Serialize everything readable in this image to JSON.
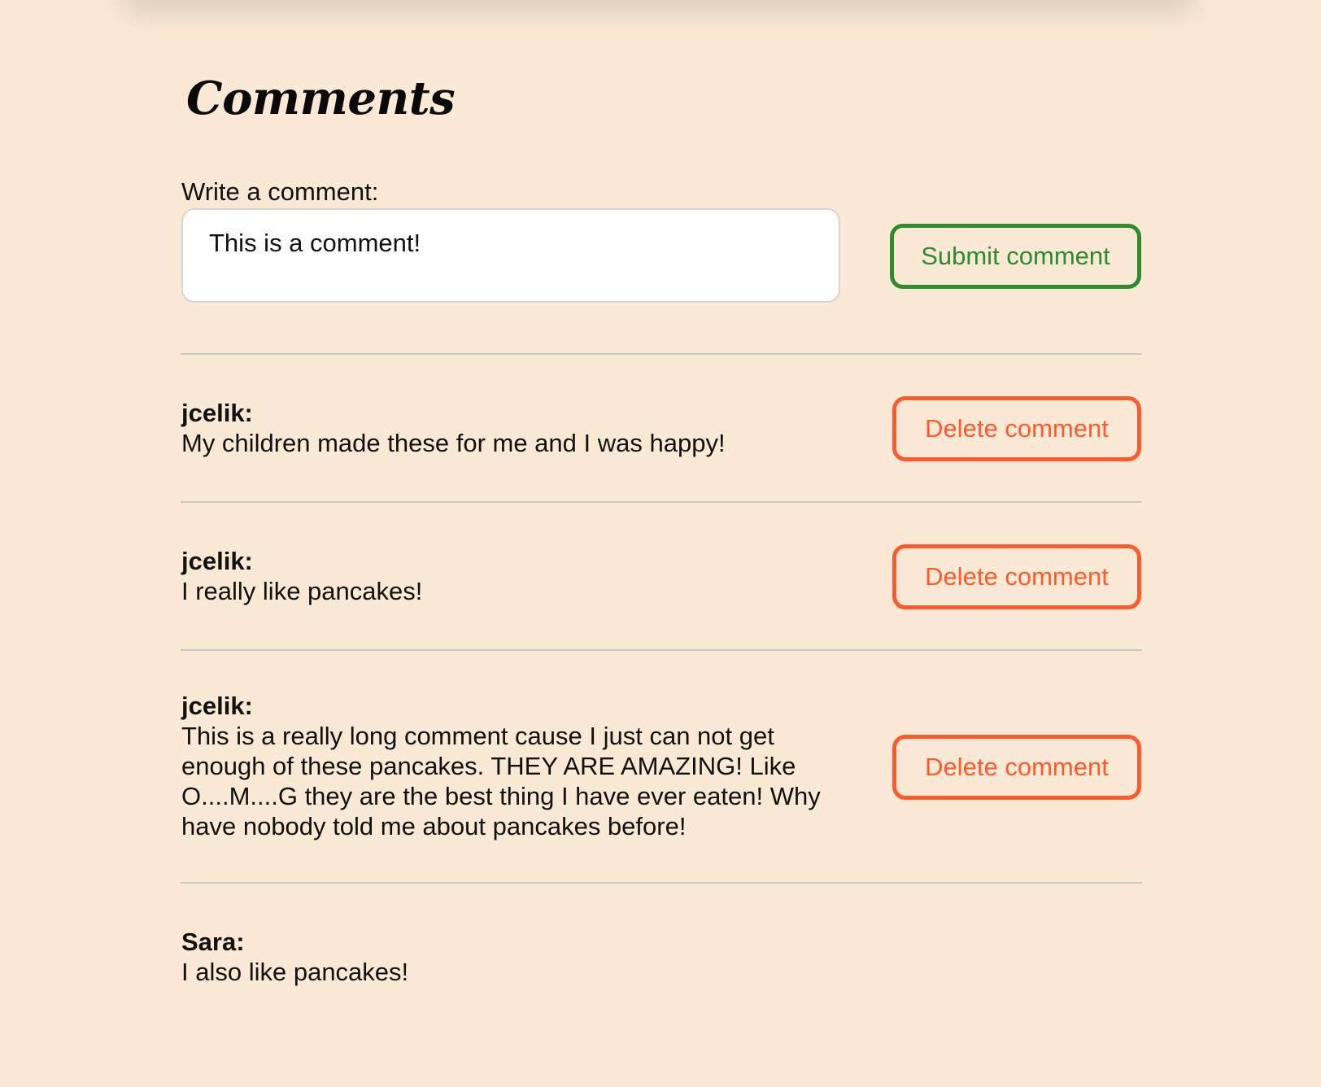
{
  "title": "Comments",
  "compose": {
    "label": "Write a comment:",
    "value": "This is a comment!",
    "submit_label": "Submit comment"
  },
  "comments": [
    {
      "author": "jcelik:",
      "text": "My children made these for me and I was happy!",
      "delete_label": "Delete comment"
    },
    {
      "author": "jcelik:",
      "text": "I really like pancakes!",
      "delete_label": "Delete comment"
    },
    {
      "author": "jcelik:",
      "text": "This is a really long comment cause I just can not get enough of these pancakes. THEY ARE AMAZING! Like O....M....G they are the best thing I have ever eaten! Why have nobody told me about pancakes before!",
      "delete_label": "Delete comment"
    },
    {
      "author": "Sara:",
      "text": "I also like pancakes!"
    }
  ],
  "colors": {
    "background": "#faead5",
    "submit": "#2e8b2e",
    "delete": "#ff5a2c",
    "divider": "#cdc9c2"
  }
}
